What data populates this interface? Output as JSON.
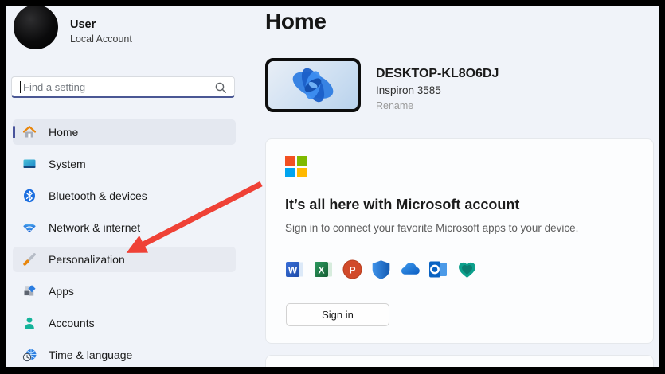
{
  "user": {
    "name": "User",
    "account_type": "Local Account",
    "avatar_icon": "user-avatar"
  },
  "search": {
    "placeholder": "Find a setting",
    "icon": "search-icon"
  },
  "sidebar": {
    "items": [
      {
        "label": "Home",
        "icon": "home-icon",
        "state": "selected"
      },
      {
        "label": "System",
        "icon": "system-icon",
        "state": "normal"
      },
      {
        "label": "Bluetooth & devices",
        "icon": "bluetooth-icon",
        "state": "normal"
      },
      {
        "label": "Network & internet",
        "icon": "network-icon",
        "state": "normal"
      },
      {
        "label": "Personalization",
        "icon": "personalization-icon",
        "state": "highlighted"
      },
      {
        "label": "Apps",
        "icon": "apps-icon",
        "state": "normal"
      },
      {
        "label": "Accounts",
        "icon": "accounts-icon",
        "state": "normal"
      },
      {
        "label": "Time & language",
        "icon": "time-language-icon",
        "state": "normal"
      }
    ]
  },
  "main": {
    "page_title": "Home",
    "device": {
      "name": "DESKTOP-KL8O6DJ",
      "model": "Inspiron 3585",
      "rename_label": "Rename"
    },
    "account_card": {
      "logo_icon": "microsoft-logo",
      "title": "It’s all here with Microsoft account",
      "subtitle": "Sign in to connect your favorite Microsoft apps to your device.",
      "app_icons": [
        "word-icon",
        "excel-icon",
        "powerpoint-icon",
        "defender-icon",
        "onedrive-icon",
        "outlook-icon",
        "family-safety-heart-icon"
      ],
      "sign_in_label": "Sign in"
    }
  },
  "annotation": {
    "type": "red-arrow",
    "color": "#ef4136"
  },
  "colors": {
    "window_border": "#000000",
    "background": "#f0f3f9",
    "selected_item_bg": "#e4e8f0",
    "accent_pill": "#4a559c",
    "search_underline": "#4a5794",
    "card_bg": "#fcfdfe",
    "arrow_red": "#ef4136",
    "ms_logo": {
      "red": "#f25022",
      "green": "#7fba00",
      "blue": "#00a4ef",
      "yellow": "#ffb900"
    }
  }
}
